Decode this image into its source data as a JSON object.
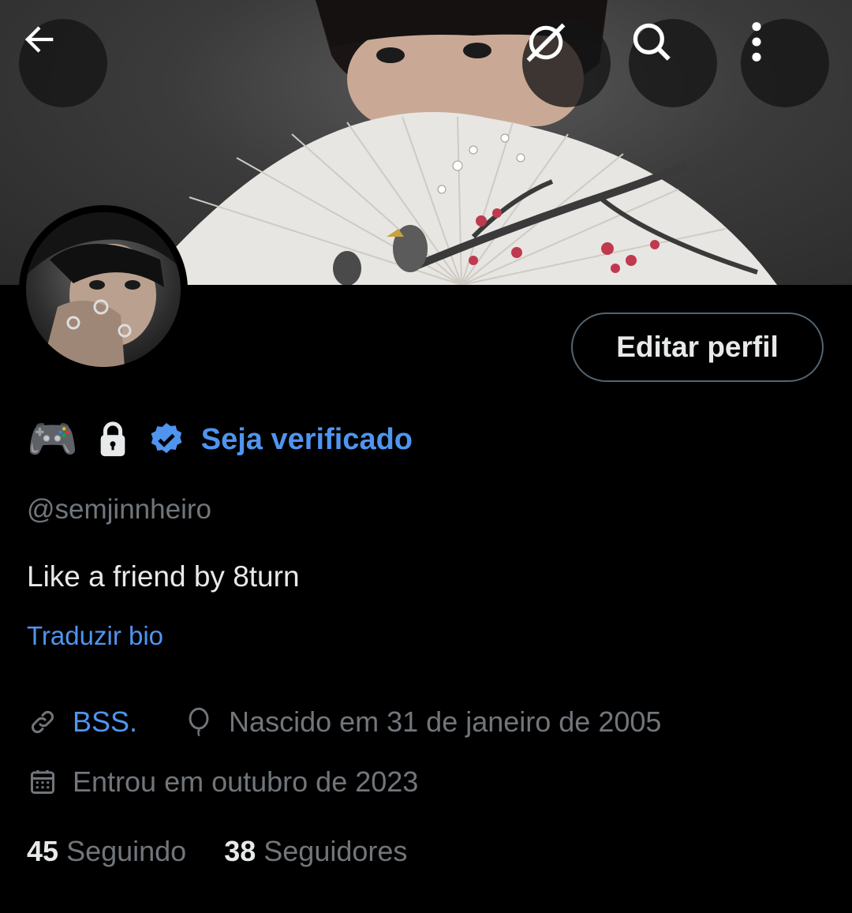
{
  "header": {
    "back_icon": "arrow-left-icon",
    "grok_icon": "grok-icon",
    "search_icon": "search-icon",
    "more_icon": "more-vertical-icon"
  },
  "profile": {
    "emoji": "🎮",
    "verify_label": "Seja verificado",
    "handle": "@semjinnheiro",
    "bio": "Like a friend by 8turn",
    "translate_label": "Traduzir bio",
    "website": "BSS.",
    "birthday": "Nascido em 31 de janeiro de 2005",
    "joined": "Entrou em outubro de 2023",
    "edit_label": "Editar perfil"
  },
  "stats": {
    "following_count": "45",
    "following_label": "Seguindo",
    "followers_count": "38",
    "followers_label": "Seguidores"
  },
  "colors": {
    "background": "#000000",
    "accent": "#4f95f0",
    "muted": "#71767b",
    "text": "#e7e9ea"
  }
}
